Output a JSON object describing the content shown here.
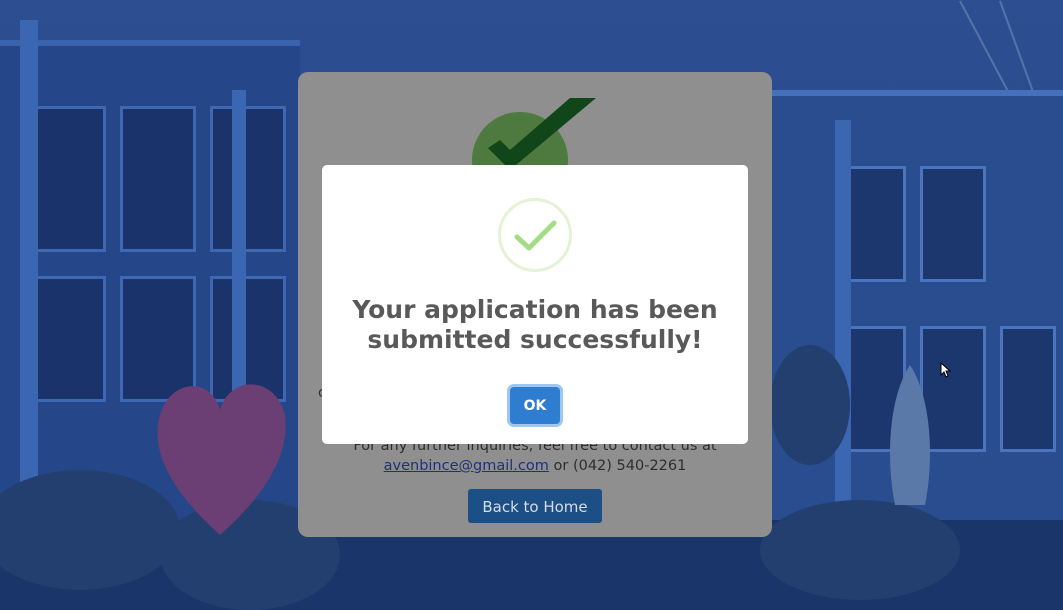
{
  "background": {
    "scene": "building-photo",
    "accent": "#1f3c7a"
  },
  "page_card": {
    "icon": "large-checkmark-icon",
    "edge_left_char": "c",
    "edge_right_char": "t",
    "contact_line1": "For any further inquiries, feel free to contact us at",
    "contact_email": "avenbince@gmail.com",
    "contact_or": " or ",
    "contact_phone": "(042) 540-2261",
    "back_home_label": "Back to Home",
    "button_color": "#1c4f86"
  },
  "modal": {
    "icon": "success-check-icon",
    "title_line1": "Your application has been",
    "title_line2": "submitted successfully!",
    "ok_label": "OK",
    "ok_color": "#2f7dd1",
    "check_color": "#a5dc86"
  }
}
